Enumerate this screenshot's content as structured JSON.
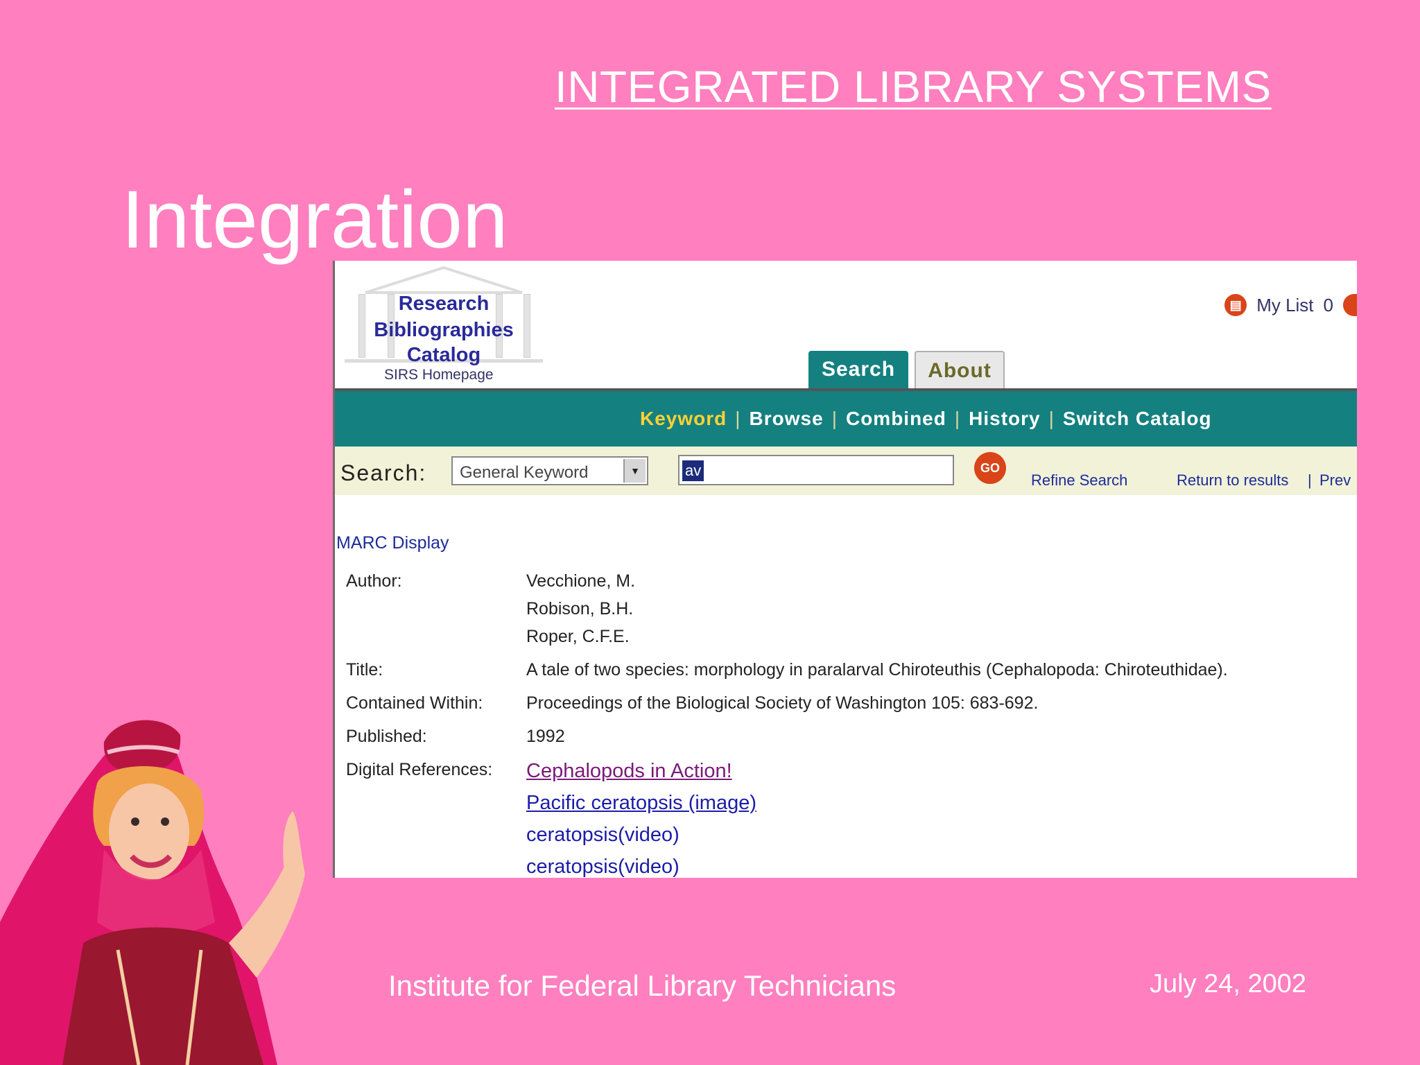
{
  "slide": {
    "header": "INTEGRATED LIBRARY SYSTEMS",
    "title": "Integration",
    "footer_left": "Institute for Federal Library Technicians",
    "footer_right": "July 24, 2002"
  },
  "catalog": {
    "logo": {
      "line1": "Research",
      "line2": "Bibliographies",
      "line3": "Catalog",
      "subtitle": "SIRS Homepage"
    },
    "mylist": {
      "label": "My List",
      "count": "0"
    },
    "tabs": [
      {
        "label": "Search"
      },
      {
        "label": "About"
      }
    ],
    "nav": [
      "Keyword",
      "Browse",
      "Combined",
      "History",
      "Switch Catalog"
    ],
    "search": {
      "label": "Search:",
      "select_value": "General Keyword",
      "input_value": "av",
      "go_label": "GO",
      "refine": "Refine Search",
      "return_results": "Return to results",
      "prev": "Prev"
    },
    "record": {
      "heading": "MARC Display",
      "author_label": "Author:",
      "authors": [
        "Vecchione, M.",
        "Robison, B.H.",
        "Roper, C.F.E."
      ],
      "title_label": "Title:",
      "title_value": "A tale of two species: morphology in paralarval Chiroteuthis (Cephalopoda: Chiroteuthidae).",
      "contained_label": "Contained Within:",
      "contained_value": "Proceedings of the Biological Society of Washington 105: 683-692.",
      "published_label": "Published:",
      "published_value": "1992",
      "digital_label": "Digital References:",
      "digital_refs": [
        "Cephalopods in Action!",
        "Pacific ceratopsis (image)",
        "ceratopsis(video)",
        "ceratopsis(video)"
      ]
    }
  }
}
